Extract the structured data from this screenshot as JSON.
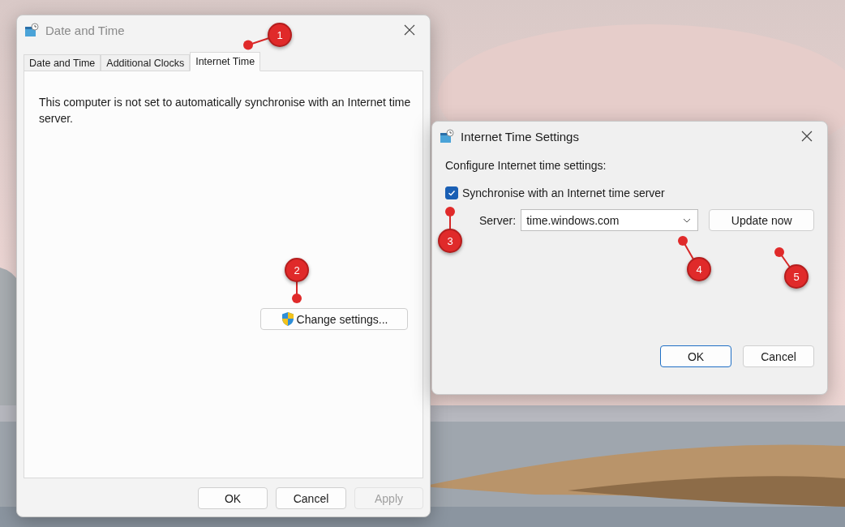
{
  "date_time_window": {
    "title": "Date and Time",
    "tabs": [
      {
        "label": "Date and Time",
        "selected": false
      },
      {
        "label": "Additional Clocks",
        "selected": false
      },
      {
        "label": "Internet Time",
        "selected": true
      }
    ],
    "message": "This computer is not set to automatically synchronise with an Internet time server.",
    "change_settings_button": "Change settings...",
    "buttons": [
      {
        "label": "OK",
        "disabled": false
      },
      {
        "label": "Cancel",
        "disabled": false
      },
      {
        "label": "Apply",
        "disabled": true
      }
    ]
  },
  "internet_time_dialog": {
    "title": "Internet Time Settings",
    "heading": "Configure Internet time settings:",
    "sync_checkbox": {
      "label": "Synchronise with an Internet time server",
      "checked": true
    },
    "server": {
      "label": "Server:",
      "value": "time.windows.com"
    },
    "update_button": "Update now",
    "buttons": [
      {
        "label": "OK",
        "default": true
      },
      {
        "label": "Cancel",
        "default": false
      }
    ]
  },
  "callouts": [
    "1",
    "2",
    "3",
    "4",
    "5"
  ]
}
